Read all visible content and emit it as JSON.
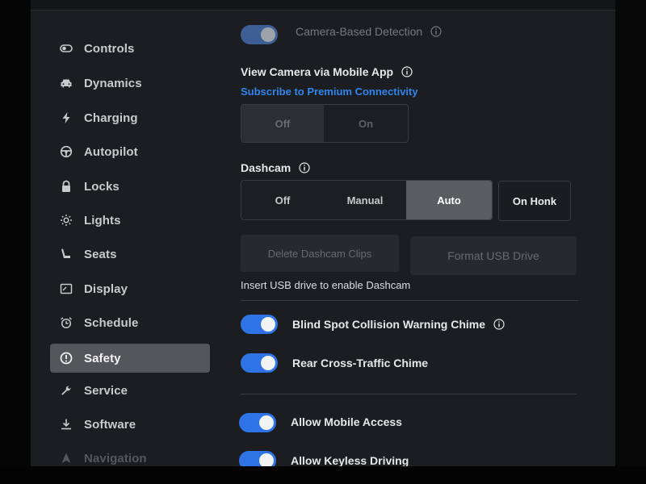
{
  "sidebar": {
    "items": [
      {
        "label": "Controls",
        "icon": "toggle-icon"
      },
      {
        "label": "Dynamics",
        "icon": "car-icon"
      },
      {
        "label": "Charging",
        "icon": "lightning-icon"
      },
      {
        "label": "Autopilot",
        "icon": "steering-wheel-icon"
      },
      {
        "label": "Locks",
        "icon": "lock-icon"
      },
      {
        "label": "Lights",
        "icon": "sun-icon"
      },
      {
        "label": "Seats",
        "icon": "seat-icon"
      },
      {
        "label": "Display",
        "icon": "display-icon"
      },
      {
        "label": "Schedule",
        "icon": "alarm-clock-icon"
      },
      {
        "label": "Safety",
        "icon": "alert-circle-icon",
        "active": true
      },
      {
        "label": "Service",
        "icon": "wrench-icon"
      },
      {
        "label": "Software",
        "icon": "download-icon"
      },
      {
        "label": "Navigation",
        "icon": "navigation-arrow-icon"
      }
    ]
  },
  "main": {
    "camera_detection": {
      "label": "Camera-Based Detection",
      "enabled": true
    },
    "view_camera": {
      "label": "View Camera via Mobile App",
      "link": "Subscribe to Premium Connectivity",
      "options": [
        "Off",
        "On"
      ],
      "selected": "Off"
    },
    "dashcam": {
      "label": "Dashcam",
      "options": [
        "Off",
        "Manual",
        "Auto"
      ],
      "selected": "Auto",
      "on_honk": "On Honk",
      "delete_clips": "Delete Dashcam Clips",
      "format_usb": "Format USB Drive",
      "hint": "Insert USB drive to enable Dashcam"
    },
    "blind_spot": {
      "label": "Blind Spot Collision Warning Chime",
      "enabled": true
    },
    "rear_cross": {
      "label": "Rear Cross-Traffic Chime",
      "enabled": true
    },
    "mobile_access": {
      "label": "Allow Mobile Access",
      "enabled": true
    },
    "keyless": {
      "label": "Allow Keyless Driving",
      "enabled": true
    }
  },
  "colors": {
    "accent": "#2f74e6",
    "link": "#2e86ef",
    "active_nav": "#55565a",
    "background": "#1c1d20"
  }
}
